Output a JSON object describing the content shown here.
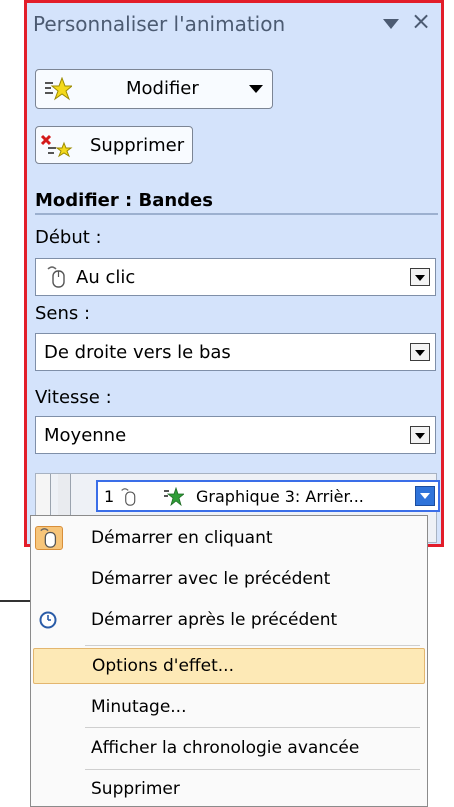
{
  "panel": {
    "title": "Personnaliser l'animation",
    "close_glyph": "×",
    "menu_icon": "dropdown-triangle-icon"
  },
  "buttons": {
    "modify": {
      "label": "Modifier",
      "icon": "star-sparkle-icon"
    },
    "delete": {
      "label": "Supprimer",
      "icon": "delete-effect-icon"
    }
  },
  "section": {
    "title": "Modifier : Bandes"
  },
  "fields": {
    "start": {
      "label": "Début :",
      "value": "Au clic",
      "icon": "mouse-icon"
    },
    "direction": {
      "label": "Sens :",
      "value": "De droite vers le bas"
    },
    "speed": {
      "label": "Vitesse :",
      "value": "Moyenne"
    }
  },
  "list": {
    "item": {
      "number": "1",
      "text": "Graphique 3: Arrièr..."
    }
  },
  "menu": {
    "items": [
      {
        "text": "Démarrer en cliquant",
        "icon": "mouse-icon"
      },
      {
        "text": "Démarrer avec le précédent"
      },
      {
        "text": "Démarrer après le précédent",
        "icon": "clock-icon"
      },
      {
        "text": "Options d'effet...",
        "highlighted": true
      },
      {
        "text": "Minutage..."
      },
      {
        "text": "Afficher la chronologie avancée"
      },
      {
        "text": "Supprimer"
      }
    ]
  },
  "colors": {
    "panel_bg": "#d4e3fb",
    "highlight_border": "#e21d2a",
    "selection_blue": "#3a6ee8",
    "menu_highlight": "#fde9b6"
  }
}
